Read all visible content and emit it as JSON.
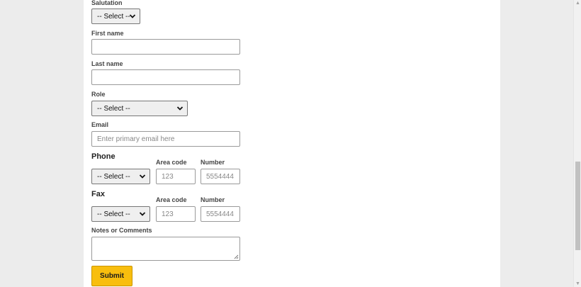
{
  "form": {
    "salutation": {
      "label": "Salutation",
      "value": "-- Select --"
    },
    "first_name": {
      "label": "First name",
      "value": ""
    },
    "last_name": {
      "label": "Last name",
      "value": ""
    },
    "role": {
      "label": "Role",
      "value": "-- Select --"
    },
    "email": {
      "label": "Email",
      "placeholder": "Enter primary email here"
    },
    "phone": {
      "heading": "Phone",
      "country_value": "-- Select --",
      "area_code_label": "Area code",
      "area_code_placeholder": "123",
      "number_label": "Number",
      "number_placeholder": "5554444"
    },
    "fax": {
      "heading": "Fax",
      "country_value": "-- Select --",
      "area_code_label": "Area code",
      "area_code_placeholder": "123",
      "number_label": "Number",
      "number_placeholder": "5554444"
    },
    "notes": {
      "label": "Notes or Comments",
      "value": ""
    },
    "submit_label": "Submit"
  },
  "icons": {
    "select_arrow": "chevron-down-icon",
    "resize": "resize-grip-icon"
  },
  "colors": {
    "submit_bg": "#f8be0e",
    "page_bg": "#ececec"
  }
}
